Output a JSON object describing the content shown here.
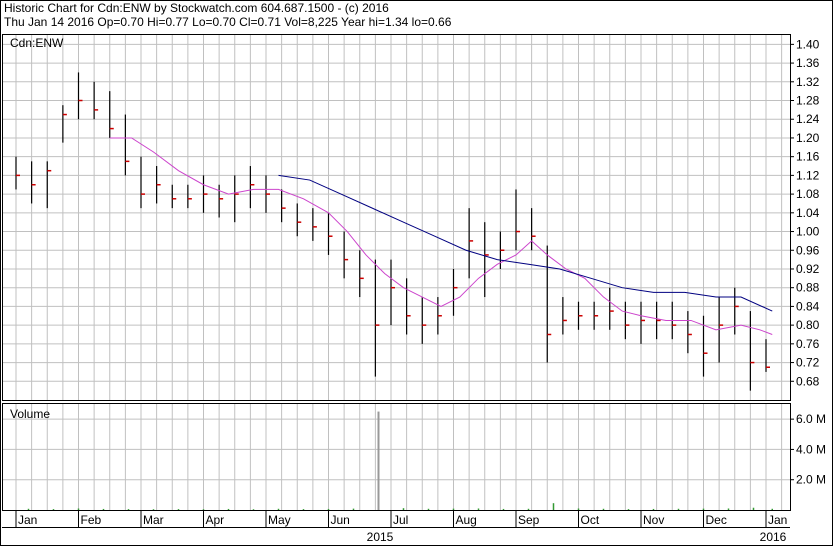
{
  "header": {
    "line1": "Historic Chart for Cdn:ENW by Stockwatch.com 604.687.1500 - (c) 2016",
    "line2": "Thu Jan 14 2016  Op=0.70  Hi=0.77  Lo=0.70  Cl=0.71  Vol=8,225  Year hi=1.34  lo=0.66"
  },
  "colors": {
    "price_bar": "#000000",
    "price_close_tick": "#cc0000",
    "ma_short": "#cc44cc",
    "ma_long": "#000080",
    "grid": "#c0c0c0",
    "volume_bar": "#999999",
    "volume_small": "#339933"
  },
  "chart_data": [
    {
      "type": "line",
      "name": "price-panel",
      "label": "Cdn:ENW",
      "x_tick_labels": [
        "Jan",
        "Feb",
        "Mar",
        "Apr",
        "May",
        "Jun",
        "Jul",
        "Aug",
        "Sep",
        "Oct",
        "Nov",
        "Dec",
        "Jan"
      ],
      "year_labels": [
        "2015",
        "2016"
      ],
      "y_ticks": [
        0.68,
        0.72,
        0.76,
        0.8,
        0.84,
        0.88,
        0.92,
        0.96,
        1.0,
        1.04,
        1.08,
        1.12,
        1.16,
        1.2,
        1.24,
        1.28,
        1.32,
        1.36,
        1.4
      ],
      "ylim": [
        0.64,
        1.42
      ],
      "grid": true,
      "x_months": [
        0,
        1,
        2,
        3,
        4,
        5,
        6,
        7,
        8,
        9,
        10,
        11,
        12
      ],
      "weekly_ohlc": [
        {
          "x": 0.0,
          "high": 1.16,
          "low": 1.09,
          "close": 1.12
        },
        {
          "x": 0.25,
          "high": 1.15,
          "low": 1.06,
          "close": 1.1
        },
        {
          "x": 0.5,
          "high": 1.15,
          "low": 1.05,
          "close": 1.13
        },
        {
          "x": 0.75,
          "high": 1.27,
          "low": 1.19,
          "close": 1.25
        },
        {
          "x": 1.0,
          "high": 1.34,
          "low": 1.24,
          "close": 1.28
        },
        {
          "x": 1.25,
          "high": 1.32,
          "low": 1.24,
          "close": 1.26
        },
        {
          "x": 1.5,
          "high": 1.3,
          "low": 1.2,
          "close": 1.22
        },
        {
          "x": 1.75,
          "high": 1.25,
          "low": 1.12,
          "close": 1.15
        },
        {
          "x": 2.0,
          "high": 1.16,
          "low": 1.05,
          "close": 1.08
        },
        {
          "x": 2.25,
          "high": 1.14,
          "low": 1.06,
          "close": 1.1
        },
        {
          "x": 2.5,
          "high": 1.1,
          "low": 1.05,
          "close": 1.07
        },
        {
          "x": 2.75,
          "high": 1.1,
          "low": 1.05,
          "close": 1.07
        },
        {
          "x": 3.0,
          "high": 1.12,
          "low": 1.04,
          "close": 1.08
        },
        {
          "x": 3.25,
          "high": 1.1,
          "low": 1.03,
          "close": 1.07
        },
        {
          "x": 3.5,
          "high": 1.12,
          "low": 1.02,
          "close": 1.08
        },
        {
          "x": 3.75,
          "high": 1.14,
          "low": 1.05,
          "close": 1.1
        },
        {
          "x": 4.0,
          "high": 1.12,
          "low": 1.04,
          "close": 1.08
        },
        {
          "x": 4.25,
          "high": 1.09,
          "low": 1.02,
          "close": 1.05
        },
        {
          "x": 4.5,
          "high": 1.06,
          "low": 0.99,
          "close": 1.02
        },
        {
          "x": 4.75,
          "high": 1.05,
          "low": 0.98,
          "close": 1.01
        },
        {
          "x": 5.0,
          "high": 1.04,
          "low": 0.95,
          "close": 0.99
        },
        {
          "x": 5.25,
          "high": 1.0,
          "low": 0.9,
          "close": 0.94
        },
        {
          "x": 5.5,
          "high": 0.96,
          "low": 0.86,
          "close": 0.9
        },
        {
          "x": 5.75,
          "high": 0.94,
          "low": 0.69,
          "close": 0.8
        },
        {
          "x": 6.0,
          "high": 0.94,
          "low": 0.8,
          "close": 0.88
        },
        {
          "x": 6.25,
          "high": 0.9,
          "low": 0.78,
          "close": 0.82
        },
        {
          "x": 6.5,
          "high": 0.86,
          "low": 0.76,
          "close": 0.8
        },
        {
          "x": 6.75,
          "high": 0.86,
          "low": 0.78,
          "close": 0.82
        },
        {
          "x": 7.0,
          "high": 0.92,
          "low": 0.82,
          "close": 0.88
        },
        {
          "x": 7.25,
          "high": 1.05,
          "low": 0.9,
          "close": 0.98
        },
        {
          "x": 7.5,
          "high": 1.02,
          "low": 0.86,
          "close": 0.95
        },
        {
          "x": 7.75,
          "high": 1.0,
          "low": 0.92,
          "close": 0.96
        },
        {
          "x": 8.0,
          "high": 1.09,
          "low": 0.96,
          "close": 1.0
        },
        {
          "x": 8.25,
          "high": 1.05,
          "low": 0.96,
          "close": 0.99
        },
        {
          "x": 8.5,
          "high": 0.97,
          "low": 0.72,
          "close": 0.78
        },
        {
          "x": 8.75,
          "high": 0.86,
          "low": 0.78,
          "close": 0.81
        },
        {
          "x": 9.0,
          "high": 0.85,
          "low": 0.79,
          "close": 0.82
        },
        {
          "x": 9.25,
          "high": 0.85,
          "low": 0.79,
          "close": 0.82
        },
        {
          "x": 9.5,
          "high": 0.88,
          "low": 0.79,
          "close": 0.83
        },
        {
          "x": 9.75,
          "high": 0.85,
          "low": 0.77,
          "close": 0.8
        },
        {
          "x": 10.0,
          "high": 0.85,
          "low": 0.76,
          "close": 0.81
        },
        {
          "x": 10.25,
          "high": 0.85,
          "low": 0.77,
          "close": 0.81
        },
        {
          "x": 10.5,
          "high": 0.85,
          "low": 0.77,
          "close": 0.8
        },
        {
          "x": 10.75,
          "high": 0.83,
          "low": 0.74,
          "close": 0.78
        },
        {
          "x": 11.0,
          "high": 0.82,
          "low": 0.69,
          "close": 0.74
        },
        {
          "x": 11.25,
          "high": 0.86,
          "low": 0.72,
          "close": 0.8
        },
        {
          "x": 11.5,
          "high": 0.88,
          "low": 0.78,
          "close": 0.84
        },
        {
          "x": 11.75,
          "high": 0.83,
          "low": 0.66,
          "close": 0.72
        },
        {
          "x": 12.0,
          "high": 0.77,
          "low": 0.7,
          "close": 0.71
        }
      ],
      "ma_short": [
        {
          "x": 1.5,
          "y": 1.2
        },
        {
          "x": 1.85,
          "y": 1.2
        },
        {
          "x": 2.2,
          "y": 1.17
        },
        {
          "x": 2.6,
          "y": 1.13
        },
        {
          "x": 3.0,
          "y": 1.1
        },
        {
          "x": 3.4,
          "y": 1.08
        },
        {
          "x": 3.8,
          "y": 1.09
        },
        {
          "x": 4.2,
          "y": 1.09
        },
        {
          "x": 4.6,
          "y": 1.07
        },
        {
          "x": 5.0,
          "y": 1.04
        },
        {
          "x": 5.3,
          "y": 1.0
        },
        {
          "x": 5.6,
          "y": 0.95
        },
        {
          "x": 5.9,
          "y": 0.91
        },
        {
          "x": 6.2,
          "y": 0.88
        },
        {
          "x": 6.5,
          "y": 0.86
        },
        {
          "x": 6.8,
          "y": 0.84
        },
        {
          "x": 7.1,
          "y": 0.86
        },
        {
          "x": 7.4,
          "y": 0.9
        },
        {
          "x": 7.7,
          "y": 0.93
        },
        {
          "x": 8.0,
          "y": 0.95
        },
        {
          "x": 8.25,
          "y": 0.98
        },
        {
          "x": 8.5,
          "y": 0.95
        },
        {
          "x": 8.8,
          "y": 0.92
        },
        {
          "x": 9.1,
          "y": 0.9
        },
        {
          "x": 9.4,
          "y": 0.86
        },
        {
          "x": 9.7,
          "y": 0.83
        },
        {
          "x": 10.0,
          "y": 0.82
        },
        {
          "x": 10.4,
          "y": 0.81
        },
        {
          "x": 10.8,
          "y": 0.81
        },
        {
          "x": 11.2,
          "y": 0.79
        },
        {
          "x": 11.6,
          "y": 0.8
        },
        {
          "x": 11.9,
          "y": 0.79
        },
        {
          "x": 12.1,
          "y": 0.78
        }
      ],
      "ma_long": [
        {
          "x": 4.2,
          "y": 1.12
        },
        {
          "x": 4.7,
          "y": 1.11
        },
        {
          "x": 5.2,
          "y": 1.08
        },
        {
          "x": 5.7,
          "y": 1.05
        },
        {
          "x": 6.2,
          "y": 1.02
        },
        {
          "x": 6.7,
          "y": 0.99
        },
        {
          "x": 7.2,
          "y": 0.96
        },
        {
          "x": 7.7,
          "y": 0.94
        },
        {
          "x": 8.2,
          "y": 0.93
        },
        {
          "x": 8.7,
          "y": 0.92
        },
        {
          "x": 9.2,
          "y": 0.9
        },
        {
          "x": 9.7,
          "y": 0.88
        },
        {
          "x": 10.2,
          "y": 0.87
        },
        {
          "x": 10.7,
          "y": 0.87
        },
        {
          "x": 11.2,
          "y": 0.86
        },
        {
          "x": 11.6,
          "y": 0.86
        },
        {
          "x": 12.1,
          "y": 0.83
        }
      ]
    },
    {
      "type": "bar",
      "name": "volume-panel",
      "label": "Volume",
      "y_tick_labels": [
        "6.0 M",
        "4.0 M",
        "2.0 M"
      ],
      "y_tick_values": [
        6.0,
        4.0,
        2.0
      ],
      "ylim": [
        0,
        7.0
      ],
      "grid": true,
      "bars": [
        {
          "x": 0.2,
          "value": 0.08
        },
        {
          "x": 0.6,
          "value": 0.06
        },
        {
          "x": 1.0,
          "value": 0.1
        },
        {
          "x": 1.4,
          "value": 0.07
        },
        {
          "x": 1.8,
          "value": 0.06
        },
        {
          "x": 2.2,
          "value": 0.05
        },
        {
          "x": 2.6,
          "value": 0.06
        },
        {
          "x": 3.0,
          "value": 0.05
        },
        {
          "x": 3.4,
          "value": 0.07
        },
        {
          "x": 3.8,
          "value": 0.05
        },
        {
          "x": 4.2,
          "value": 0.08
        },
        {
          "x": 4.6,
          "value": 0.06
        },
        {
          "x": 5.0,
          "value": 0.07
        },
        {
          "x": 5.4,
          "value": 0.09
        },
        {
          "x": 5.8,
          "value": 6.5
        },
        {
          "x": 6.2,
          "value": 0.12
        },
        {
          "x": 6.6,
          "value": 0.08
        },
        {
          "x": 7.0,
          "value": 0.09
        },
        {
          "x": 7.4,
          "value": 0.1
        },
        {
          "x": 7.8,
          "value": 0.07
        },
        {
          "x": 8.2,
          "value": 0.08
        },
        {
          "x": 8.6,
          "value": 0.45
        },
        {
          "x": 9.0,
          "value": 0.1
        },
        {
          "x": 9.4,
          "value": 0.08
        },
        {
          "x": 9.8,
          "value": 0.06
        },
        {
          "x": 10.2,
          "value": 0.07
        },
        {
          "x": 10.6,
          "value": 0.08
        },
        {
          "x": 11.0,
          "value": 0.09
        },
        {
          "x": 11.4,
          "value": 0.1
        },
        {
          "x": 11.8,
          "value": 0.15
        },
        {
          "x": 12.1,
          "value": 0.08
        }
      ]
    }
  ]
}
